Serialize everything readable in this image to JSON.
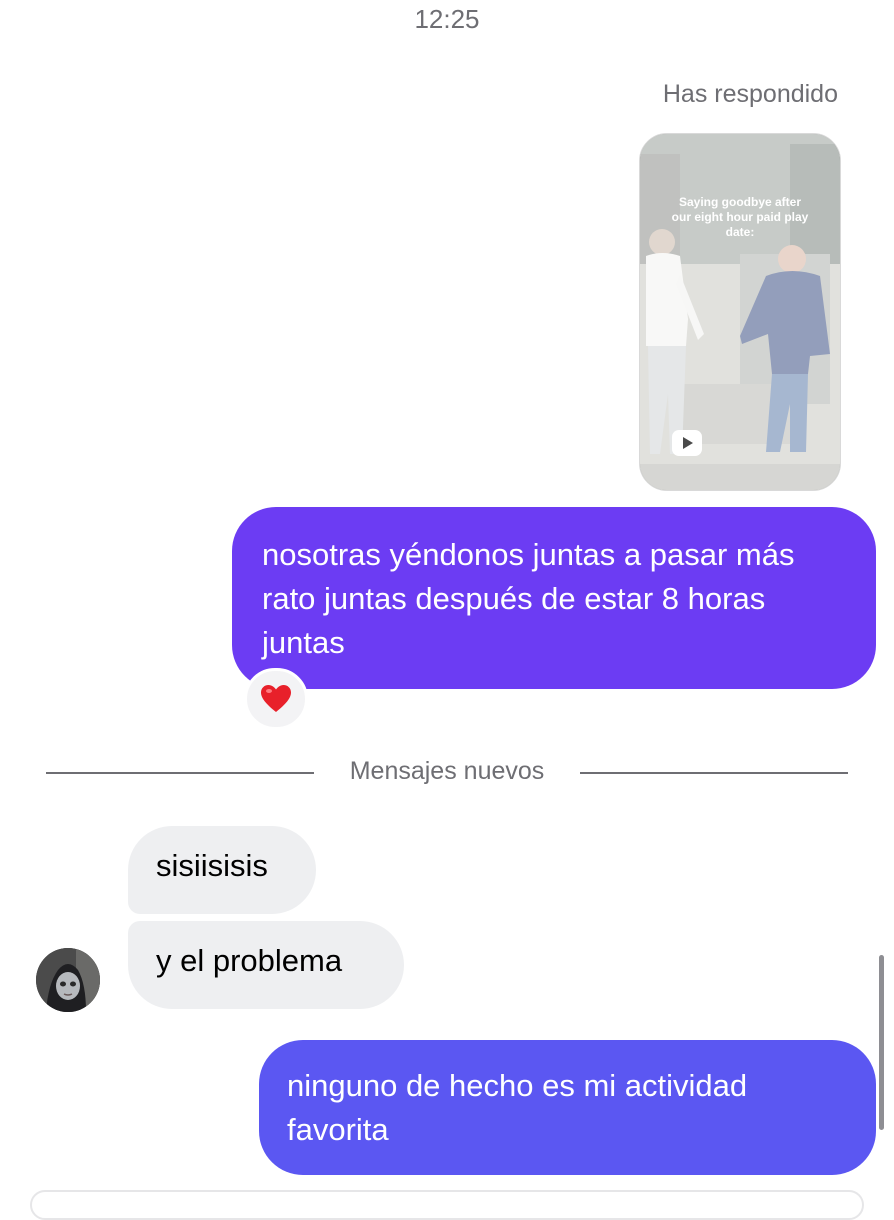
{
  "header": {
    "time": "12:25"
  },
  "reply_context": {
    "label": "Has respondido",
    "reel": {
      "caption": "Saying goodbye after our eight hour paid play date:",
      "icon": "play-icon"
    }
  },
  "messages": [
    {
      "id": "sent-1",
      "direction": "sent",
      "text": "nosotras yéndonos juntas a pasar más rato juntas después de estar 8 horas juntas",
      "reaction": "❤️"
    },
    {
      "id": "recv-1",
      "direction": "received",
      "text": "sisiisisis"
    },
    {
      "id": "recv-2",
      "direction": "received",
      "text": "y el problema"
    },
    {
      "id": "sent-2",
      "direction": "sent",
      "text": "ninguno de hecho es mi actividad favorita"
    }
  ],
  "divider": {
    "label": "Mensajes nuevos"
  },
  "colors": {
    "sent_bubble_top": "#6c3cf3",
    "sent_bubble_bottom": "#5b57f2",
    "received_bubble": "#eeeff1",
    "meta_text": "#6e6e73",
    "heart": "#e8202a"
  }
}
